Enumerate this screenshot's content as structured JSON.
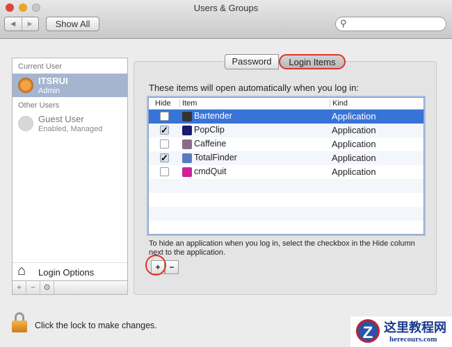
{
  "window": {
    "title": "Users & Groups"
  },
  "toolbar": {
    "show_all": "Show All",
    "search_placeholder": ""
  },
  "sidebar": {
    "current_user_header": "Current User",
    "current_user": {
      "name": "ITSRUI",
      "role": "Admin"
    },
    "other_users_header": "Other Users",
    "other_users": [
      {
        "name": "Guest User",
        "status": "Enabled, Managed"
      }
    ],
    "login_options": "Login Options",
    "footer": {
      "add": "+",
      "remove": "−",
      "gear": "⚙"
    }
  },
  "tabs": [
    {
      "label": "Password",
      "active": false
    },
    {
      "label": "Login Items",
      "active": true
    }
  ],
  "login_items": {
    "intro": "These items will open automatically when you log in:",
    "columns": {
      "hide": "Hide",
      "item": "Item",
      "kind": "Kind"
    },
    "rows": [
      {
        "hide": false,
        "name": "Bartender",
        "kind": "Application",
        "selected": true,
        "icon": "bartender-icon",
        "color": "#333333"
      },
      {
        "hide": true,
        "name": "PopClip",
        "kind": "Application",
        "selected": false,
        "icon": "popclip-icon",
        "color": "#1a1a6e"
      },
      {
        "hide": false,
        "name": "Caffeine",
        "kind": "Application",
        "selected": false,
        "icon": "caffeine-icon",
        "color": "#8a6a8a"
      },
      {
        "hide": true,
        "name": "TotalFinder",
        "kind": "Application",
        "selected": false,
        "icon": "totalfinder-icon",
        "color": "#5a7ac0"
      },
      {
        "hide": false,
        "name": "cmdQuit",
        "kind": "Application",
        "selected": false,
        "icon": "cmdquit-icon",
        "color": "#d0209a"
      }
    ],
    "note": "To hide an application when you log in, select the checkbox in the Hide column next to the application.",
    "add": "+",
    "remove": "−"
  },
  "lock": {
    "text": "Click the lock to make changes."
  },
  "watermark": {
    "title": "这里教程网",
    "url": "herecours.com"
  },
  "colors": {
    "selection": "#3874d8",
    "annotation": "#e0302a"
  }
}
